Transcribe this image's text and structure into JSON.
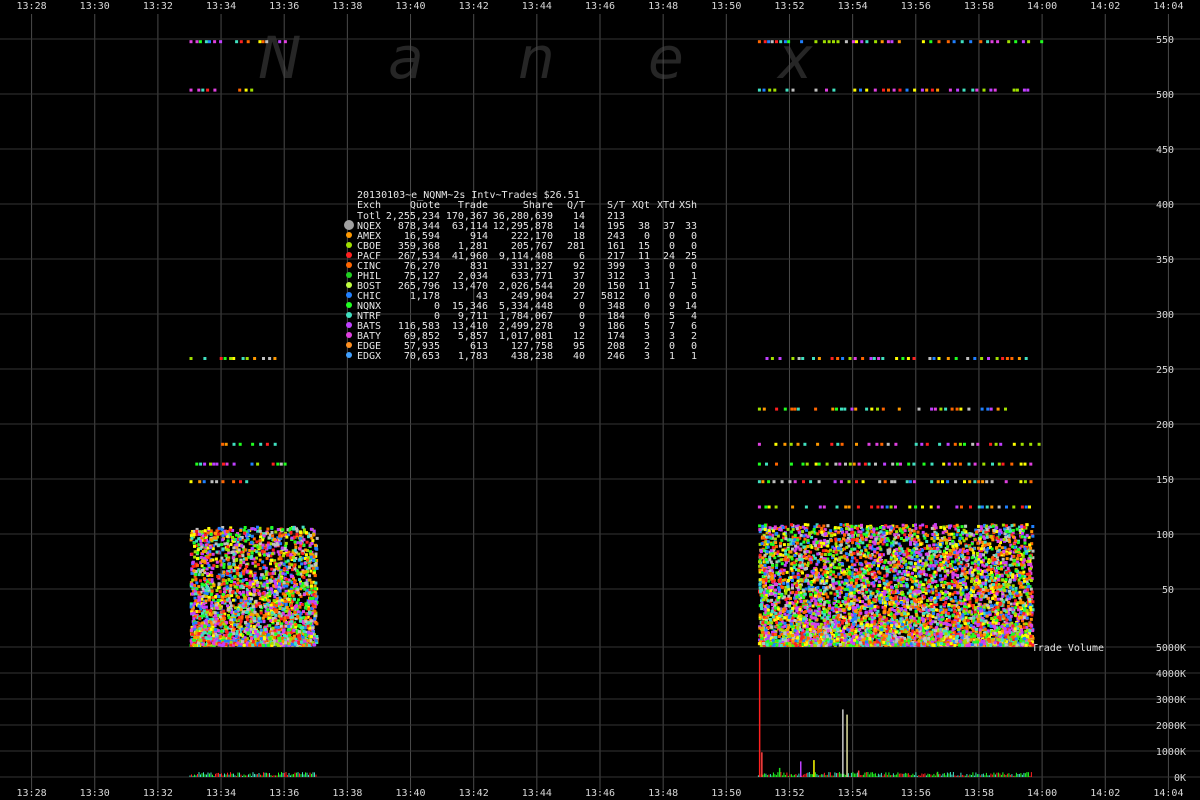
{
  "chart_data": {
    "type": "scatter",
    "title": "20130103~e_NQNM~2s Intv~Trades $26.51",
    "watermark": [
      "N",
      "a",
      "n",
      "e",
      "x"
    ],
    "x_ticks": [
      "13:28",
      "13:30",
      "13:32",
      "13:34",
      "13:36",
      "13:38",
      "13:40",
      "13:42",
      "13:44",
      "13:46",
      "13:48",
      "13:50",
      "13:52",
      "13:54",
      "13:56",
      "13:58",
      "14:00",
      "14:02",
      "14:04"
    ],
    "xlim": [
      "13:27",
      "14:05"
    ],
    "trades_panel": {
      "ylim": [
        0,
        560
      ],
      "y_ticks": [
        50,
        100,
        150,
        200,
        250,
        300,
        350,
        400,
        450,
        500,
        550
      ]
    },
    "volume_panel": {
      "label": "Trade Volume",
      "ylim": [
        0,
        5000
      ],
      "y_ticks": [
        {
          "value": 0,
          "label": "0K"
        },
        {
          "value": 1000,
          "label": "1000K"
        },
        {
          "value": 2000,
          "label": "2000K"
        },
        {
          "value": 3000,
          "label": "3000K"
        },
        {
          "value": 4000,
          "label": "4000K"
        },
        {
          "value": 5000,
          "label": "5000K"
        }
      ],
      "spikes": [
        {
          "time": "13:51:02",
          "value": 4700,
          "color": "#ff2020"
        },
        {
          "time": "13:51:06",
          "value": 950,
          "color": "#ff4040"
        },
        {
          "time": "13:51:40",
          "value": 350,
          "color": "#20e020"
        },
        {
          "time": "13:52:20",
          "value": 600,
          "color": "#c040ff"
        },
        {
          "time": "13:52:45",
          "value": 650,
          "color": "#ffff00"
        },
        {
          "time": "13:53:40",
          "value": 2600,
          "color": "#c8c8c8"
        },
        {
          "time": "13:53:48",
          "value": 2400,
          "color": "#e0e0a0"
        },
        {
          "time": "13:54:10",
          "value": 250,
          "color": "#ff4040"
        },
        {
          "time": "13:56:40",
          "value": 200,
          "color": "#20e020"
        }
      ]
    },
    "trade_sessions": [
      {
        "start": "13:33:00",
        "end": "13:37:00",
        "min": 0,
        "max": 108
      },
      {
        "start": "13:51:00",
        "end": "13:59:40",
        "min": 0,
        "max": 110
      }
    ],
    "price_bands": [
      {
        "value": 548,
        "start": "13:33:00",
        "end": "13:36:00"
      },
      {
        "value": 504,
        "start": "13:33:00",
        "end": "13:35:00"
      },
      {
        "value": 260,
        "start": "13:33:00",
        "end": "13:35:40"
      },
      {
        "value": 182,
        "start": "13:34:00",
        "end": "13:35:40"
      },
      {
        "value": 164,
        "start": "13:33:00",
        "end": "13:36:20"
      },
      {
        "value": 148,
        "start": "13:33:00",
        "end": "13:35:00"
      },
      {
        "value": 548,
        "start": "13:51:00",
        "end": "14:00:00"
      },
      {
        "value": 504,
        "start": "13:51:00",
        "end": "13:59:40"
      },
      {
        "value": 260,
        "start": "13:51:00",
        "end": "14:00:00"
      },
      {
        "value": 214,
        "start": "13:51:00",
        "end": "13:59:00"
      },
      {
        "value": 182,
        "start": "13:51:00",
        "end": "14:00:00"
      },
      {
        "value": 164,
        "start": "13:51:00",
        "end": "13:59:40"
      },
      {
        "value": 148,
        "start": "13:51:00",
        "end": "13:59:40"
      },
      {
        "value": 125,
        "start": "13:51:00",
        "end": "13:59:40"
      }
    ],
    "table": {
      "headers": [
        "Exch",
        "Quote",
        "Trade",
        "Share",
        "Q/T",
        "S/T",
        "XQt",
        "XTd",
        "XSh"
      ],
      "rows": [
        {
          "exch": "Totl",
          "color": "",
          "values": [
            "2,255,234",
            "170,367",
            "36,280,639",
            "14",
            "213",
            "",
            "",
            ""
          ]
        },
        {
          "exch": "NQEX",
          "color": "#a0a0a0",
          "values": [
            "878,344",
            "63,114",
            "12,295,878",
            "14",
            "195",
            "38",
            "37",
            "33"
          ]
        },
        {
          "exch": "AMEX",
          "color": "#ff9900",
          "values": [
            "16,594",
            "914",
            "222,170",
            "18",
            "243",
            "0",
            "0",
            "0"
          ]
        },
        {
          "exch": "CBOE",
          "color": "#a0e000",
          "values": [
            "359,368",
            "1,281",
            "205,767",
            "281",
            "161",
            "15",
            "0",
            "0"
          ]
        },
        {
          "exch": "PACF",
          "color": "#ff2020",
          "values": [
            "267,534",
            "41,960",
            "9,114,408",
            "6",
            "217",
            "11",
            "24",
            "25"
          ]
        },
        {
          "exch": "CINC",
          "color": "#ff6600",
          "values": [
            "76,270",
            "831",
            "331,327",
            "92",
            "399",
            "3",
            "0",
            "0"
          ]
        },
        {
          "exch": "PHIL",
          "color": "#20d020",
          "values": [
            "75,127",
            "2,034",
            "633,771",
            "37",
            "312",
            "3",
            "1",
            "1"
          ]
        },
        {
          "exch": "BOST",
          "color": "#c0ff40",
          "values": [
            "265,796",
            "13,470",
            "2,026,544",
            "20",
            "150",
            "11",
            "7",
            "5"
          ]
        },
        {
          "exch": "CHIC",
          "color": "#2080ff",
          "values": [
            "1,178",
            "43",
            "249,904",
            "27",
            "5812",
            "0",
            "0",
            "0"
          ]
        },
        {
          "exch": "NQNX",
          "color": "#20ff20",
          "values": [
            "0",
            "15,346",
            "5,334,448",
            "0",
            "348",
            "0",
            "9",
            "14"
          ]
        },
        {
          "exch": "NTRF",
          "color": "#40e0c0",
          "values": [
            "0",
            "9,711",
            "1,784,067",
            "0",
            "184",
            "0",
            "5",
            "4"
          ]
        },
        {
          "exch": "BATS",
          "color": "#c040ff",
          "values": [
            "116,583",
            "13,410",
            "2,499,278",
            "9",
            "186",
            "5",
            "7",
            "6"
          ]
        },
        {
          "exch": "BATY",
          "color": "#e040e0",
          "values": [
            "69,852",
            "5,857",
            "1,017,081",
            "12",
            "174",
            "3",
            "3",
            "2"
          ]
        },
        {
          "exch": "EDGE",
          "color": "#ff9020",
          "values": [
            "57,935",
            "613",
            "127,758",
            "95",
            "208",
            "2",
            "0",
            "0"
          ]
        },
        {
          "exch": "EDGX",
          "color": "#40a0ff",
          "values": [
            "70,653",
            "1,783",
            "438,238",
            "40",
            "246",
            "3",
            "1",
            "1"
          ]
        }
      ]
    }
  },
  "colors": {
    "background": "#000000",
    "grid": "#4a4a4a",
    "text": "#d8d8d8",
    "palette": [
      "#20ff20",
      "#ff2020",
      "#40e0c0",
      "#c040ff",
      "#e040e0",
      "#ffff00",
      "#a0e000",
      "#ff9900",
      "#c0c0c0",
      "#2080ff",
      "#ff6600"
    ]
  }
}
